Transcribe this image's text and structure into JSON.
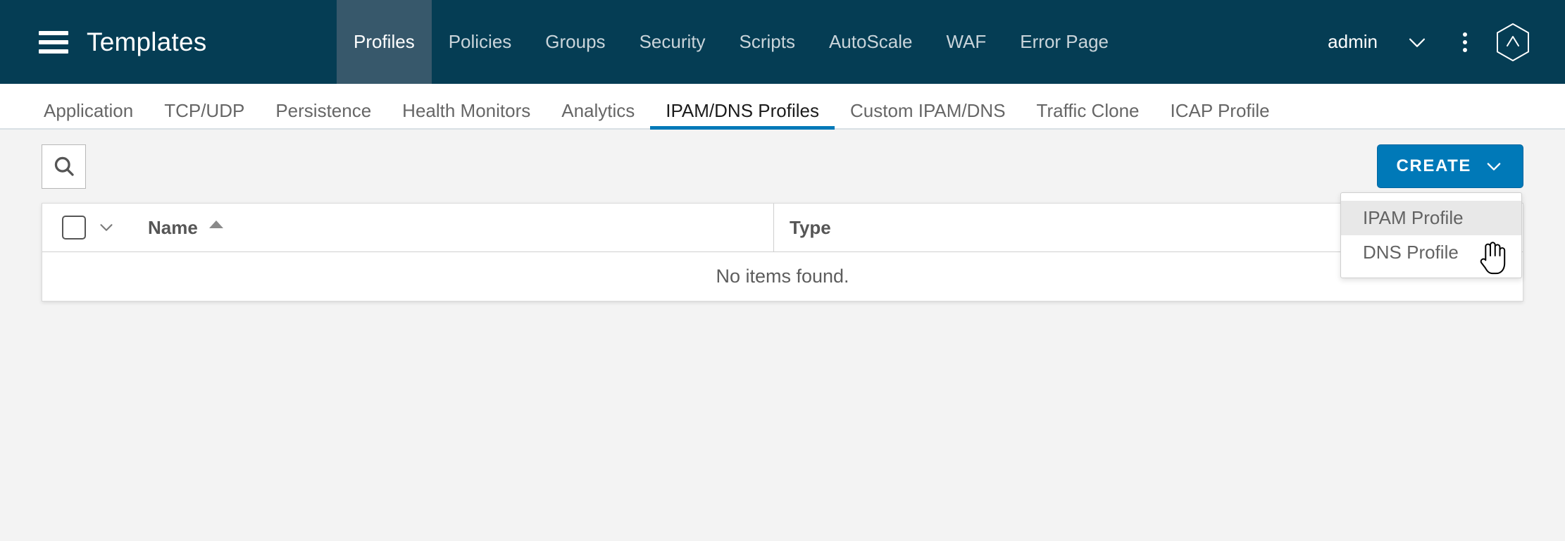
{
  "header": {
    "menu_icon": "hamburger-icon",
    "title": "Templates",
    "tabs": [
      {
        "label": "Profiles",
        "active": true
      },
      {
        "label": "Policies",
        "active": false
      },
      {
        "label": "Groups",
        "active": false
      },
      {
        "label": "Security",
        "active": false
      },
      {
        "label": "Scripts",
        "active": false
      },
      {
        "label": "AutoScale",
        "active": false
      },
      {
        "label": "WAF",
        "active": false
      },
      {
        "label": "Error Page",
        "active": false
      }
    ],
    "user": "admin",
    "chevron_icon": "chevron-down-icon",
    "overflow_icon": "more-vertical-icon",
    "logo_icon": "hexagon-logo-icon",
    "bg_color": "#053D54",
    "active_tab_color": "#37586B"
  },
  "subnav": {
    "tabs": [
      {
        "label": "Application",
        "active": false
      },
      {
        "label": "TCP/UDP",
        "active": false
      },
      {
        "label": "Persistence",
        "active": false
      },
      {
        "label": "Health Monitors",
        "active": false
      },
      {
        "label": "Analytics",
        "active": false
      },
      {
        "label": "IPAM/DNS Profiles",
        "active": true
      },
      {
        "label": "Custom IPAM/DNS",
        "active": false
      },
      {
        "label": "Traffic Clone",
        "active": false
      },
      {
        "label": "ICAP Profile",
        "active": false
      }
    ],
    "active_underline_color": "#0079b8"
  },
  "toolbar": {
    "search_icon": "search-icon",
    "search_placeholder": "",
    "search_value": "",
    "create_label": "CREATE",
    "create_chevron_icon": "chevron-down-icon",
    "create_color": "#0079b8"
  },
  "create_menu": {
    "open": true,
    "items": [
      {
        "label": "IPAM Profile",
        "hovered": true
      },
      {
        "label": "DNS Profile",
        "hovered": false
      }
    ],
    "hover_color": "#e8e8e8"
  },
  "table": {
    "select_all_checkbox": "unchecked",
    "select_all_caret_icon": "chevron-down-icon",
    "columns": [
      {
        "label": "Name",
        "sort": "asc",
        "sort_icon": "sort-ascending-icon"
      },
      {
        "label": "Type",
        "sort": "none"
      }
    ],
    "rows": [],
    "empty_message": "No items found."
  },
  "cursor": {
    "icon": "pointing-hand-cursor"
  }
}
